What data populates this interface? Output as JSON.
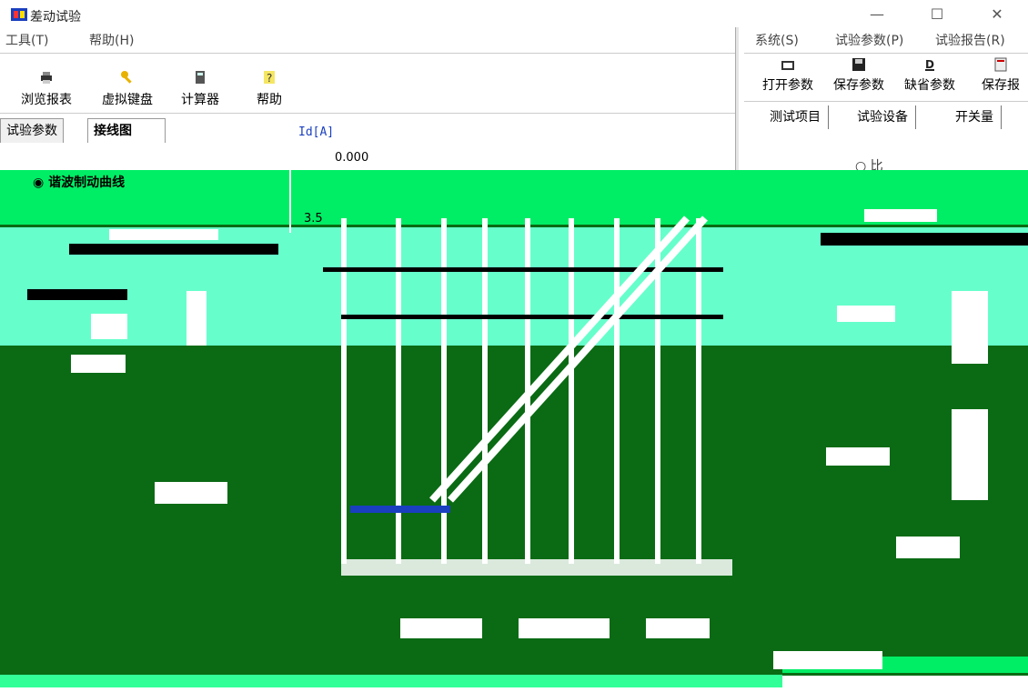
{
  "window": {
    "title": "差动试验",
    "controls": {
      "minimize": "—",
      "maximize": "☐",
      "close": "✕"
    }
  },
  "menubar_left": [
    "工具(T)",
    "帮助(H)"
  ],
  "menubar_right": [
    "系统(S)",
    "试验参数(P)",
    "试验报告(R)"
  ],
  "toolbar_left": [
    {
      "label": "浏览报表",
      "icon": "printer-icon"
    },
    {
      "label": "虚拟键盘",
      "icon": "key-icon"
    },
    {
      "label": "计算器",
      "icon": "calculator-icon"
    },
    {
      "label": "帮助",
      "icon": "help-icon"
    }
  ],
  "toolbar_right": [
    {
      "label": "打开参数",
      "icon": "folder-open-icon"
    },
    {
      "label": "保存参数",
      "icon": "save-icon"
    },
    {
      "label": "缺省参数",
      "icon": "default-icon"
    },
    {
      "label": "保存报",
      "icon": "save-report-icon"
    }
  ],
  "tabs_left": [
    {
      "label": "试验参数",
      "active": false
    },
    {
      "label": "接线图",
      "active": true
    }
  ],
  "tabs_right": [
    "测试项目",
    "试验设备",
    "开关量"
  ],
  "chart": {
    "ylabel": "Id[A]",
    "tick_top": "0.000",
    "tick_mid": "3.5"
  },
  "options": {
    "harmonic": "谐波制动曲线",
    "ratio": "比"
  },
  "colors": {
    "overlay_green": "#00ee66",
    "overlay_dark": "#0a6b14",
    "overlay_light": "#66ffcc",
    "axis_blue": "#1a3fbf"
  }
}
